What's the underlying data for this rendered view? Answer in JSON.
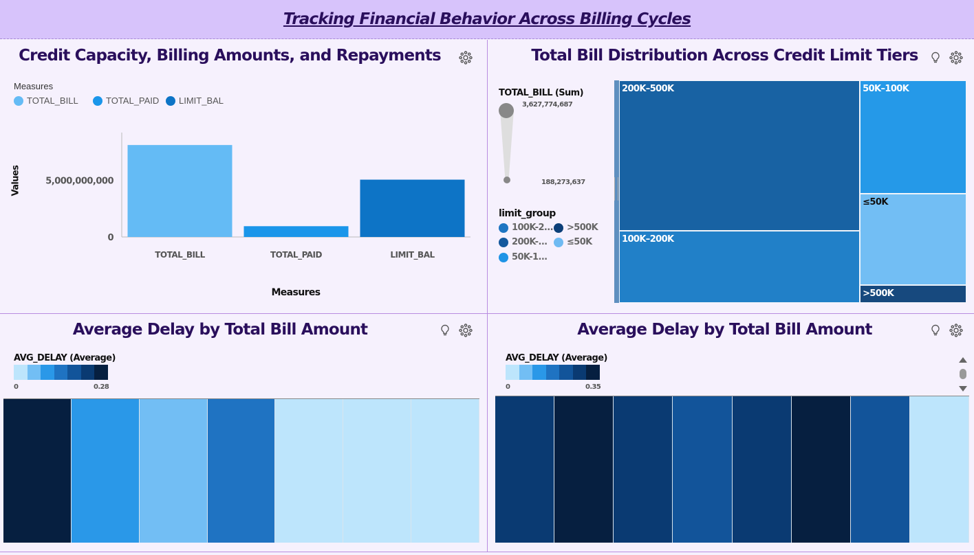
{
  "dashboard": {
    "title": "Tracking Financial Behavior Across Billing Cycles"
  },
  "panel_capacity": {
    "title": "Credit Capacity, Billing Amounts, and Repayments",
    "legend_title": "Measures",
    "y_axis_label": "Values",
    "x_axis_label": "Measures",
    "y_ticks": [
      "5,000,000,000",
      "0"
    ],
    "chart_data": {
      "type": "bar",
      "categories": [
        "TOTAL_BILL",
        "TOTAL_PAID",
        "LIMIT_BAL"
      ],
      "values": [
        8100000000,
        950000000,
        5050000000
      ],
      "colors": [
        "#64bbf5",
        "#1a96ea",
        "#0d74c6"
      ],
      "ylabel": "Values",
      "xlabel": "Measures",
      "ylim": [
        0,
        9500000000
      ],
      "legend_placement": "top-left"
    }
  },
  "panel_treemap": {
    "title": "Total Bill Distribution Across Credit Limit Tiers",
    "size_legend_title": "TOTAL_BILL (Sum)",
    "size_max": "3,627,774,687",
    "size_min": "188,273,637",
    "group_legend_title": "limit_group",
    "group_legend": [
      {
        "label": "100K-2...",
        "color": "#1e75c2"
      },
      {
        "label": ">500K",
        "color": "#0c3f78"
      },
      {
        "label": "200K-...",
        "color": "#14589d"
      },
      {
        "label": "≤50K",
        "color": "#6fbaf2"
      },
      {
        "label": "50K-1...",
        "color": "#1f94e6"
      }
    ],
    "chart_data": {
      "type": "treemap",
      "items": [
        {
          "label": "200K–500K",
          "value": 3627774687,
          "color": "#1862a3"
        },
        {
          "label": "100K–200K",
          "value": 1750000000,
          "color": "#2180c8"
        },
        {
          "label": "50K–100K",
          "value": 1210000000,
          "color": "#2599e8"
        },
        {
          "label": "≤50K",
          "value": 980000000,
          "color": "#72bef4"
        },
        {
          "label": ">500K",
          "value": 188273637,
          "color": "#17497e"
        }
      ]
    }
  },
  "panel_delay_left": {
    "title": "Average Delay by Total Bill Amount",
    "legend_title": "AVG_DELAY (Average)",
    "legend_min": "0",
    "legend_max": "0.28",
    "chart_data": {
      "type": "heatmap",
      "measure": "AVG_DELAY (Average)",
      "range": [
        0,
        0.28
      ],
      "values": [
        0.28,
        0.07,
        0.06,
        0.14,
        0.01,
        0.01,
        0.01
      ]
    }
  },
  "panel_delay_right": {
    "title": "Average Delay by Total Bill Amount",
    "legend_title": "AVG_DELAY (Average)",
    "legend_min": "0",
    "legend_max": "0.35",
    "chart_data": {
      "type": "heatmap",
      "measure": "AVG_DELAY (Average)",
      "range": [
        0,
        0.35
      ],
      "values": [
        0.27,
        0.33,
        0.28,
        0.22,
        0.3,
        0.35,
        0.26,
        0.01
      ]
    }
  },
  "palette": {
    "heat_swatches": [
      "#bde5fc",
      "#72bef4",
      "#2a98e8",
      "#1f73c2",
      "#12549a",
      "#0a3a72",
      "#061f40"
    ],
    "banner_bg": "#d7c3fb",
    "title_color": "#2a0f5c"
  },
  "icons": {
    "settings": "settings-icon",
    "insight": "lightbulb-icon",
    "scroll_up": "scroll-up-icon",
    "scroll_down": "scroll-down-icon"
  }
}
